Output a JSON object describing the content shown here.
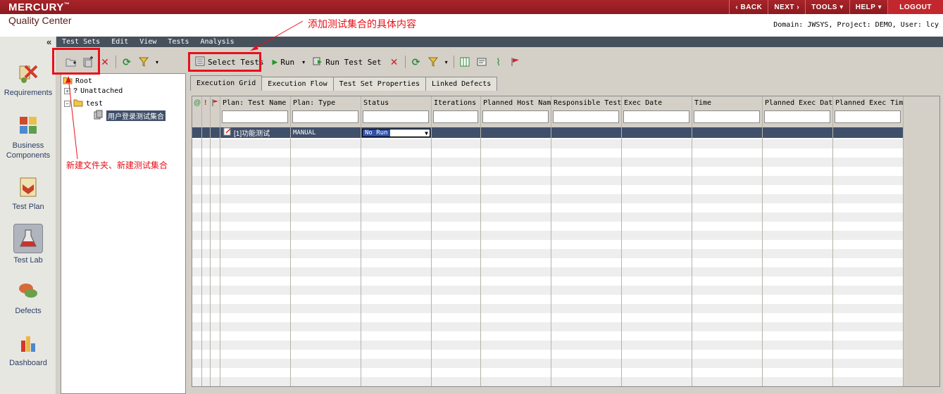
{
  "header": {
    "logo": "MERCURY",
    "logo_tm": "™",
    "product": "Quality Center",
    "nav": [
      "BACK",
      "NEXT",
      "TOOLS",
      "HELP"
    ],
    "logout": "LOGOUT",
    "context": "Domain: JWSYS, Project: DEMO, User: lcy"
  },
  "modules": [
    {
      "label": "Requirements",
      "icon": "requirements-icon"
    },
    {
      "label": "Business Components",
      "icon": "business-components-icon"
    },
    {
      "label": "Test Plan",
      "icon": "test-plan-icon"
    },
    {
      "label": "Test Lab",
      "icon": "test-lab-icon",
      "selected": true
    },
    {
      "label": "Defects",
      "icon": "defects-icon"
    },
    {
      "label": "Dashboard",
      "icon": "dashboard-icon"
    }
  ],
  "menu": [
    "Test Sets",
    "Edit",
    "View",
    "Tests",
    "Analysis"
  ],
  "tree": {
    "root": "Root",
    "unattached": "Unattached",
    "folder": "test",
    "test_set": "用户登录测试集合"
  },
  "toolbar": {
    "select_tests": "Select Tests",
    "run": "Run",
    "run_test_set": "Run Test Set"
  },
  "tabs": [
    "Execution Grid",
    "Execution Flow",
    "Test Set Properties",
    "Linked Defects"
  ],
  "grid": {
    "columns": [
      "Plan: Test Name",
      "Plan: Type",
      "Status",
      "Iterations",
      "Planned Host Nam",
      "Responsible Test",
      "Exec Date",
      "Time",
      "Planned Exec Dat",
      "Planned Exec Tim"
    ],
    "rows": [
      {
        "test_name": "[1]功能测试",
        "type": "MANUAL",
        "status": "No Run"
      }
    ]
  },
  "annotations": {
    "select_tests": "添加测试集合的具体内容",
    "new_folder": "新建文件夹、新建测试集合"
  },
  "colors": {
    "brand": "#8c1a1f",
    "menu_bar": "#46515c",
    "selection": "#41506a",
    "annotation": "#e8101a"
  }
}
